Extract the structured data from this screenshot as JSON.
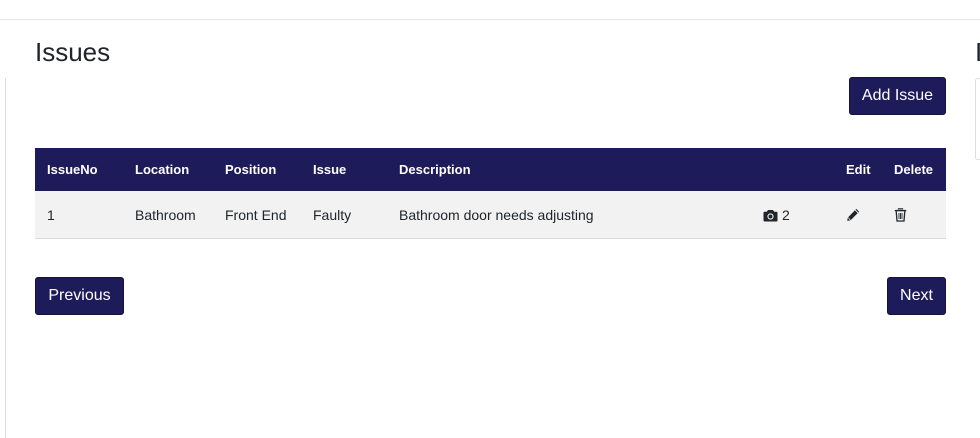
{
  "page": {
    "title": "Issues",
    "right_panel_title": "I"
  },
  "toolbar": {
    "add_label": "Add Issue"
  },
  "table": {
    "columns": [
      "IssueNo",
      "Location",
      "Position",
      "Issue",
      "Description",
      "Edit",
      "Delete"
    ],
    "rows": [
      {
        "issue_no": "1",
        "location": "Bathroom",
        "position": "Front End",
        "issue": "Faulty",
        "description": "Bathroom door needs adjusting",
        "photo_count": "2",
        "photo_icon": "camera-icon",
        "edit_icon": "pencil-icon",
        "delete_icon": "trash-icon"
      }
    ]
  },
  "pagination": {
    "previous_label": "Previous",
    "next_label": "Next"
  },
  "colors": {
    "primary": "#1e1b5a",
    "row_background": "#f2f2f2"
  }
}
